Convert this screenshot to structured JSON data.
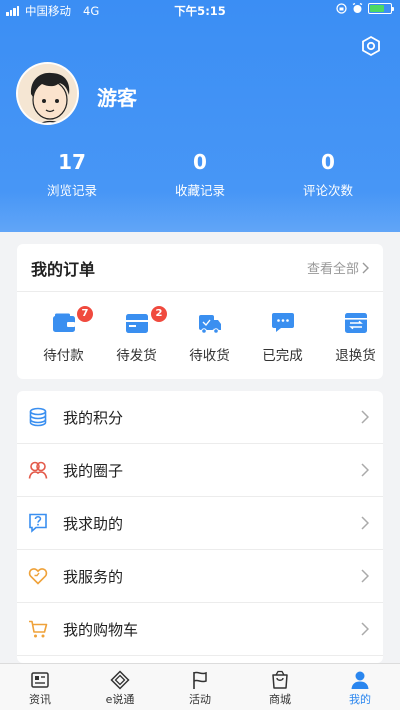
{
  "status_bar": {
    "carrier": "中国移动",
    "network": "4G",
    "time": "下午5:15"
  },
  "profile": {
    "username": "游客",
    "stats": [
      {
        "value": "17",
        "label": "浏览记录"
      },
      {
        "value": "0",
        "label": "收藏记录"
      },
      {
        "value": "0",
        "label": "评论次数"
      }
    ]
  },
  "orders": {
    "title": "我的订单",
    "view_all": "查看全部",
    "items": [
      {
        "label": "待付款",
        "badge": "7",
        "icon": "wallet-icon"
      },
      {
        "label": "待发货",
        "badge": "2",
        "icon": "package-icon"
      },
      {
        "label": "待收货",
        "badge": "",
        "icon": "truck-icon"
      },
      {
        "label": "已完成",
        "badge": "",
        "icon": "chat-dots-icon"
      },
      {
        "label": "退换货",
        "badge": "",
        "icon": "exchange-icon"
      }
    ]
  },
  "menu": {
    "items": [
      {
        "label": "我的积分",
        "icon": "coins-icon"
      },
      {
        "label": "我的圈子",
        "icon": "people-icon"
      },
      {
        "label": "我求助的",
        "icon": "question-icon"
      },
      {
        "label": "我服务的",
        "icon": "heart-icon"
      },
      {
        "label": "我的购物车",
        "icon": "cart-icon"
      }
    ]
  },
  "tabbar": {
    "items": [
      {
        "label": "资讯",
        "icon": "news-icon"
      },
      {
        "label": "e说通",
        "icon": "diamond-icon"
      },
      {
        "label": "活动",
        "icon": "flag-icon"
      },
      {
        "label": "商城",
        "icon": "bag-icon"
      },
      {
        "label": "我的",
        "icon": "user-icon",
        "active": true
      }
    ]
  },
  "colors": {
    "header": "#3b8ef4",
    "accent": "#2a86ef",
    "badge": "#f04a3e",
    "icon_blue": "#3a8ff0",
    "icon_red": "#e35a4a",
    "icon_orange": "#efa23a"
  }
}
